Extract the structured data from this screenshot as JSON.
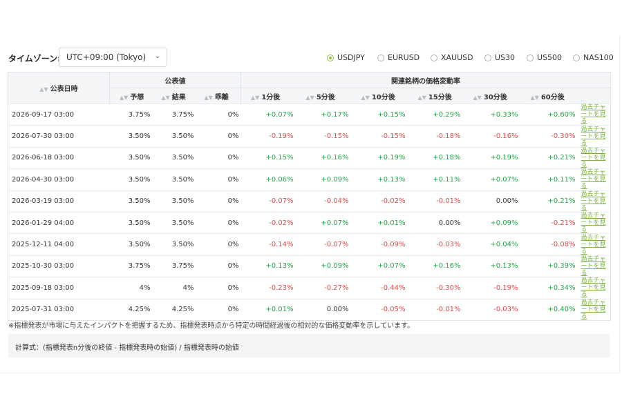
{
  "timezone": {
    "label": "タイムゾーン:",
    "value": "UTC+09:00 (Tokyo)"
  },
  "symbols": [
    {
      "label": "USDJPY",
      "selected": true
    },
    {
      "label": "EURUSD",
      "selected": false
    },
    {
      "label": "XAUUSD",
      "selected": false
    },
    {
      "label": "US30",
      "selected": false
    },
    {
      "label": "US500",
      "selected": false
    },
    {
      "label": "NAS100",
      "selected": false
    }
  ],
  "table": {
    "group_headers": {
      "date": "公表日時",
      "published": "公表値",
      "impact": "関連銘柄の価格変動率"
    },
    "sub_headers": {
      "forecast": "予想",
      "actual": "結果",
      "deviation": "乖離",
      "m1": "1分後",
      "m5": "5分後",
      "m10": "10分後",
      "m15": "15分後",
      "m30": "30分後",
      "m60": "60分後"
    },
    "chart_link": "過去チャートを見る",
    "rows": [
      {
        "date": "2026-09-17 03:00",
        "forecast": "3.75%",
        "actual": "3.75%",
        "deviation": "0%",
        "m1": "+0.07%",
        "m5": "+0.17%",
        "m10": "+0.15%",
        "m15": "+0.29%",
        "m30": "+0.33%",
        "m60": "+0.60%"
      },
      {
        "date": "2026-07-30 03:00",
        "forecast": "3.50%",
        "actual": "3.50%",
        "deviation": "0%",
        "m1": "-0.19%",
        "m5": "-0.15%",
        "m10": "-0.15%",
        "m15": "-0.18%",
        "m30": "-0.16%",
        "m60": "-0.30%"
      },
      {
        "date": "2026-06-18 03:00",
        "forecast": "3.50%",
        "actual": "3.50%",
        "deviation": "0%",
        "m1": "+0.15%",
        "m5": "+0.16%",
        "m10": "+0.19%",
        "m15": "+0.18%",
        "m30": "+0.19%",
        "m60": "+0.21%"
      },
      {
        "date": "2026-04-30 03:00",
        "forecast": "3.50%",
        "actual": "3.50%",
        "deviation": "0%",
        "m1": "+0.06%",
        "m5": "+0.09%",
        "m10": "+0.13%",
        "m15": "+0.11%",
        "m30": "+0.07%",
        "m60": "+0.11%"
      },
      {
        "date": "2026-03-19 03:00",
        "forecast": "3.50%",
        "actual": "3.50%",
        "deviation": "0%",
        "m1": "-0.07%",
        "m5": "-0.04%",
        "m10": "-0.02%",
        "m15": "-0.01%",
        "m30": "0.00%",
        "m60": "+0.21%"
      },
      {
        "date": "2026-01-29 04:00",
        "forecast": "3.50%",
        "actual": "3.50%",
        "deviation": "0%",
        "m1": "-0.02%",
        "m5": "+0.07%",
        "m10": "+0.01%",
        "m15": "0.00%",
        "m30": "+0.09%",
        "m60": "-0.21%"
      },
      {
        "date": "2025-12-11 04:00",
        "forecast": "3.50%",
        "actual": "3.50%",
        "deviation": "0%",
        "m1": "-0.14%",
        "m5": "-0.07%",
        "m10": "-0.09%",
        "m15": "-0.03%",
        "m30": "+0.04%",
        "m60": "-0.08%"
      },
      {
        "date": "2025-10-30 03:00",
        "forecast": "3.75%",
        "actual": "3.75%",
        "deviation": "0%",
        "m1": "+0.13%",
        "m5": "+0.09%",
        "m10": "+0.07%",
        "m15": "+0.16%",
        "m30": "+0.13%",
        "m60": "+0.39%"
      },
      {
        "date": "2025-09-18 03:00",
        "forecast": "4%",
        "actual": "4%",
        "deviation": "0%",
        "m1": "-0.23%",
        "m5": "-0.27%",
        "m10": "-0.44%",
        "m15": "-0.30%",
        "m30": "-0.19%",
        "m60": "+0.34%"
      },
      {
        "date": "2025-07-31 03:00",
        "forecast": "4.25%",
        "actual": "4.25%",
        "deviation": "0%",
        "m1": "+0.01%",
        "m5": "0.00%",
        "m10": "-0.05%",
        "m15": "-0.01%",
        "m30": "-0.03%",
        "m60": "+0.40%"
      }
    ]
  },
  "note": "※指標発表が市場に与えたインパクトを把握するため、指標発表時点から特定の時間経過後の相対的な価格変動率を示しています。",
  "formula": "計算式：(指標発表n分後の終値 - 指標発表時の始値) / 指標発表時の始値",
  "colors": {
    "positive": "#22a447",
    "negative": "#e04848",
    "accent": "#8bc34a",
    "link": "#7cb342",
    "header_bg": "#f3f5f7"
  }
}
